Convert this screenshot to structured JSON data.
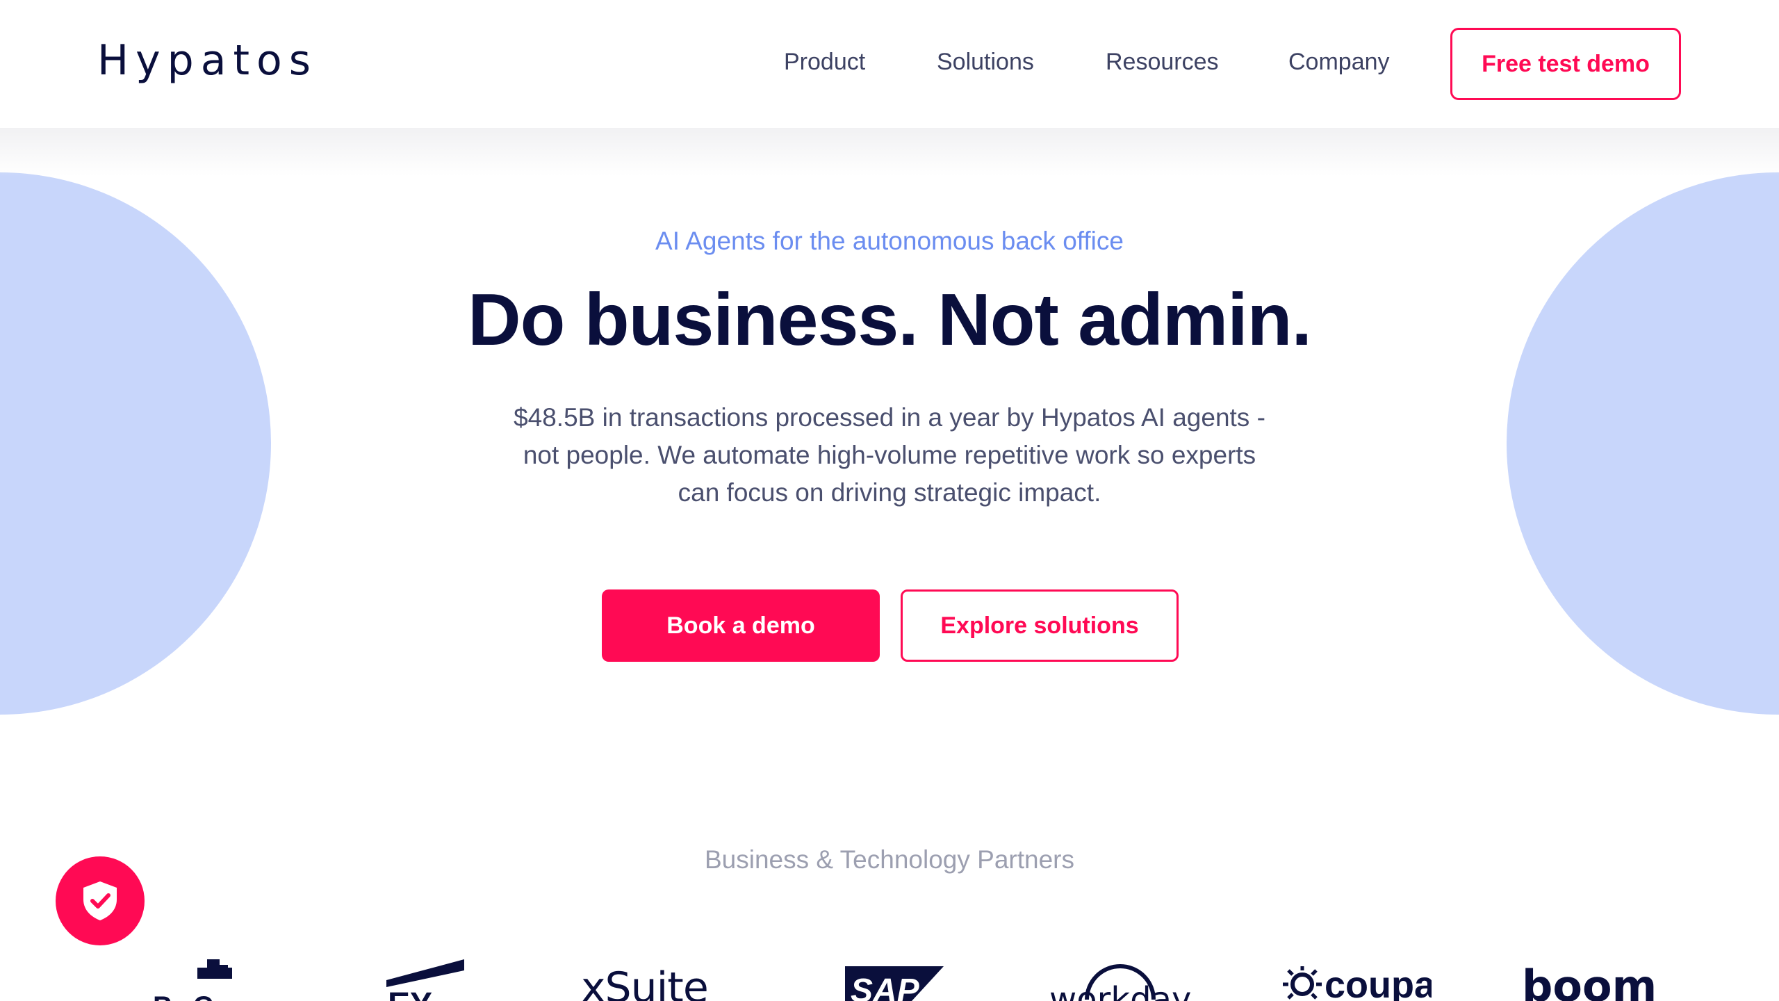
{
  "header": {
    "logo": "Hypatos",
    "nav": [
      "Product",
      "Solutions",
      "Resources",
      "Company"
    ],
    "cta": "Free test demo"
  },
  "hero": {
    "eyebrow": "AI Agents for the autonomous back office",
    "headline": "Do business. Not admin.",
    "subtext": "$48.5B in transactions processed in a year by Hypatos AI agents - not people. We automate high-volume repetitive work so experts can focus on driving strategic impact.",
    "primary_button": "Book a demo",
    "secondary_button": "Explore solutions"
  },
  "partners": {
    "title": "Business & Technology Partners",
    "logos": [
      "PwC",
      "EY",
      "xSuite",
      "SAP",
      "workday",
      "coupa",
      "boomi"
    ]
  },
  "privacy_badge": {
    "icon": "shield-check-icon"
  },
  "colors": {
    "accent": "#ff0a54",
    "navy": "#0a0f3c",
    "circle": "#c8d6fb",
    "eyebrow": "#6b8df0"
  }
}
